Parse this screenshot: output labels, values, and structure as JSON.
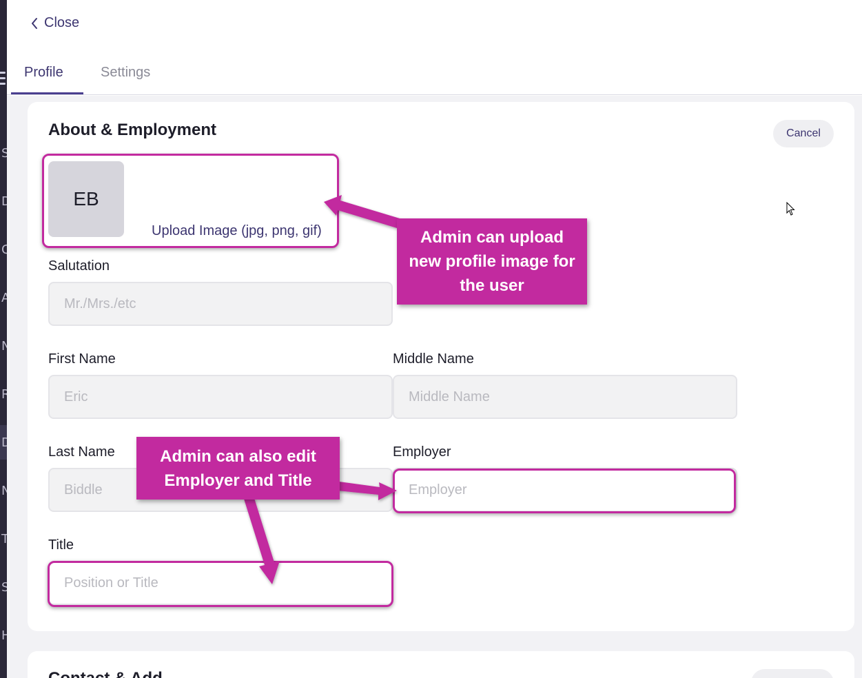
{
  "nav": {
    "close_label": "Close"
  },
  "tabs": [
    {
      "label": "Profile",
      "active": true
    },
    {
      "label": "Settings",
      "active": false
    }
  ],
  "sidebar_letters": [
    "S",
    "D",
    "C",
    "A",
    "N",
    "R",
    "D",
    "N",
    "T",
    "S",
    "H"
  ],
  "about": {
    "title": "About & Employment",
    "cancel_label": "Cancel",
    "avatar_initials": "EB",
    "upload_label": "Upload Image (jpg, png, gif)",
    "fields": {
      "salutation": {
        "label": "Salutation",
        "placeholder": "Mr./Mrs./etc"
      },
      "first_name": {
        "label": "First Name",
        "placeholder": "Eric"
      },
      "middle_name": {
        "label": "Middle Name",
        "placeholder": "Middle Name"
      },
      "last_name": {
        "label": "Last Name",
        "placeholder": "Biddle"
      },
      "employer": {
        "label": "Employer",
        "placeholder": "Employer"
      },
      "title": {
        "label": "Title",
        "placeholder": "Position or Title"
      }
    }
  },
  "contact": {
    "title": "Contact & Add"
  },
  "annotations": {
    "upload_callout": [
      "Admin can upload",
      "new profile image for",
      "the user"
    ],
    "edit_callout": [
      "Admin can also edit",
      "Employer and Title"
    ],
    "color": "#c22a9f"
  }
}
